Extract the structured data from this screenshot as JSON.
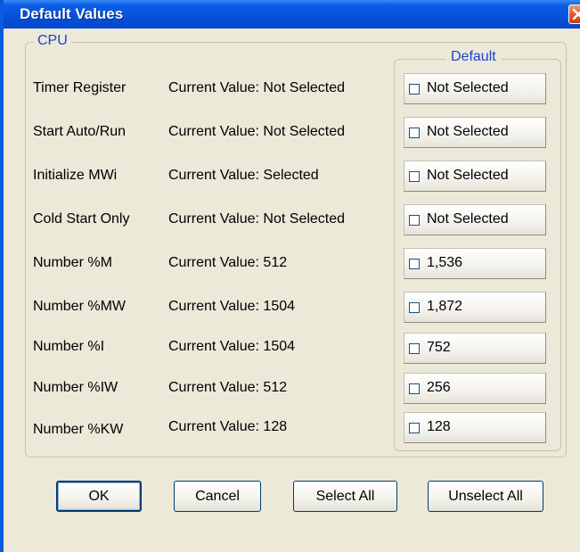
{
  "window": {
    "title": "Default Values"
  },
  "group": {
    "legend": "CPU"
  },
  "default_group": {
    "legend": "Default"
  },
  "rows": [
    {
      "label": "Timer Register",
      "current": "Current Value: Not Selected",
      "default": "Not Selected",
      "checked": false
    },
    {
      "label": "Start Auto/Run",
      "current": "Current Value: Not Selected",
      "default": "Not Selected",
      "checked": false
    },
    {
      "label": "Initialize MWi",
      "current": "Current Value: Selected",
      "default": "Not Selected",
      "checked": false
    },
    {
      "label": "Cold Start Only",
      "current": "Current Value: Not Selected",
      "default": "Not Selected",
      "checked": false
    },
    {
      "label": "Number %M",
      "current": "Current Value: 512",
      "default": "1,536",
      "checked": false
    },
    {
      "label": "Number %MW",
      "current": "Current Value: 1504",
      "default": "1,872",
      "checked": false
    },
    {
      "label": "Number %I",
      "current": "Current Value: 1504",
      "default": "752",
      "checked": false
    },
    {
      "label": "Number %IW",
      "current": "Current Value: 512",
      "default": "256",
      "checked": false
    },
    {
      "label": "Number %KW",
      "current": "Current Value: 128",
      "default": "128",
      "checked": false
    }
  ],
  "buttons": {
    "ok": "OK",
    "cancel": "Cancel",
    "select_all": "Select All",
    "unselect_all": "Unselect All"
  },
  "icons": {
    "close": "close-icon"
  },
  "colors": {
    "title_bar": "#0550dc",
    "legend": "#1f3fd4",
    "close": "#e05a2a",
    "dialog_bg": "#ece9d8"
  }
}
